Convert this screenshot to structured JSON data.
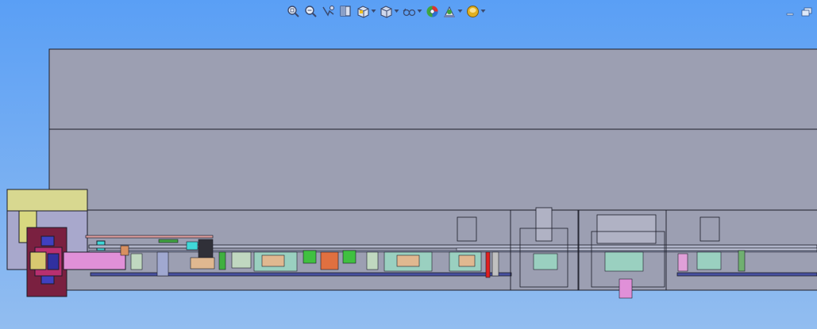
{
  "viewport": {
    "bg_top": "#5a9ff5",
    "bg_bottom": "#92bdf0"
  },
  "toolbar": {
    "items": [
      {
        "icon": "zoom-to-fit-icon",
        "dropdown": false
      },
      {
        "icon": "zoom-to-area-icon",
        "dropdown": false
      },
      {
        "icon": "previous-view-icon",
        "dropdown": false
      },
      {
        "icon": "section-view-icon",
        "dropdown": false
      },
      {
        "icon": "view-orientation-icon",
        "dropdown": true
      },
      {
        "icon": "display-style-icon",
        "dropdown": true
      },
      {
        "icon": "hide-show-items-icon",
        "dropdown": true
      },
      {
        "icon": "edit-appearance-icon",
        "dropdown": false
      },
      {
        "icon": "apply-scene-icon",
        "dropdown": true
      },
      {
        "icon": "view-settings-icon",
        "dropdown": true
      }
    ]
  },
  "window_controls": {
    "minimize": "minimize-icon",
    "restore": "restore-icon"
  },
  "model_colors": {
    "housing": "#9c9fb2",
    "edge": "#1c1d28",
    "pink": "#e090d8",
    "maroon": "#7a2040",
    "teal": "#8fd0d0",
    "green": "#40c040",
    "red": "#e02020",
    "olive": "#d8d890",
    "tan": "#e0b890"
  }
}
